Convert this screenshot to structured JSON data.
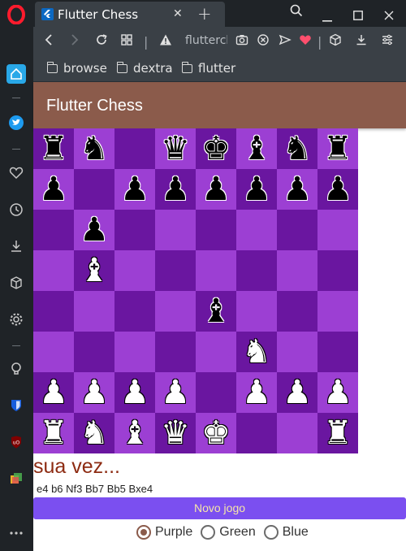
{
  "browser": {
    "tab_title": "Flutter Chess",
    "url_text": "flutterch",
    "bookmarks": [
      "browse",
      "dextra",
      "flutter"
    ],
    "colors": {
      "frame": "#1f2327",
      "toolbar": "#3a4046",
      "sidebar_accent": "#29a8e8"
    }
  },
  "app": {
    "title": "Flutter Chess",
    "turn_text": "sua vez...",
    "moves_text": "e4 b6 Nf3 Bb7 Bb5 Bxe4",
    "new_game_label": "Novo jogo",
    "theme_options": [
      "Purple",
      "Green",
      "Blue"
    ],
    "selected_theme": "Purple",
    "colors": {
      "appbar": "#8b5b4b",
      "light_square": "#9c3fd3",
      "dark_square": "#6a16a0",
      "button": "#7b4ff0",
      "turn_text": "#8d2b12"
    }
  },
  "board": [
    [
      "br",
      "bn",
      "",
      "bq",
      "bk",
      "bb",
      "bn",
      "br"
    ],
    [
      "bp",
      "",
      "bp",
      "bp",
      "bp",
      "bp",
      "bp",
      "bp"
    ],
    [
      "",
      "bp",
      "",
      "",
      "",
      "",
      "",
      ""
    ],
    [
      "",
      "wb",
      "",
      "",
      "",
      "",
      "",
      ""
    ],
    [
      "",
      "",
      "",
      "",
      "bb",
      "",
      "",
      ""
    ],
    [
      "",
      "",
      "",
      "",
      "",
      "wn",
      "",
      ""
    ],
    [
      "wp",
      "wp",
      "wp",
      "wp",
      "",
      "wp",
      "wp",
      "wp"
    ],
    [
      "wr",
      "wn",
      "wb",
      "wq",
      "wk",
      "",
      "",
      "wr"
    ]
  ]
}
